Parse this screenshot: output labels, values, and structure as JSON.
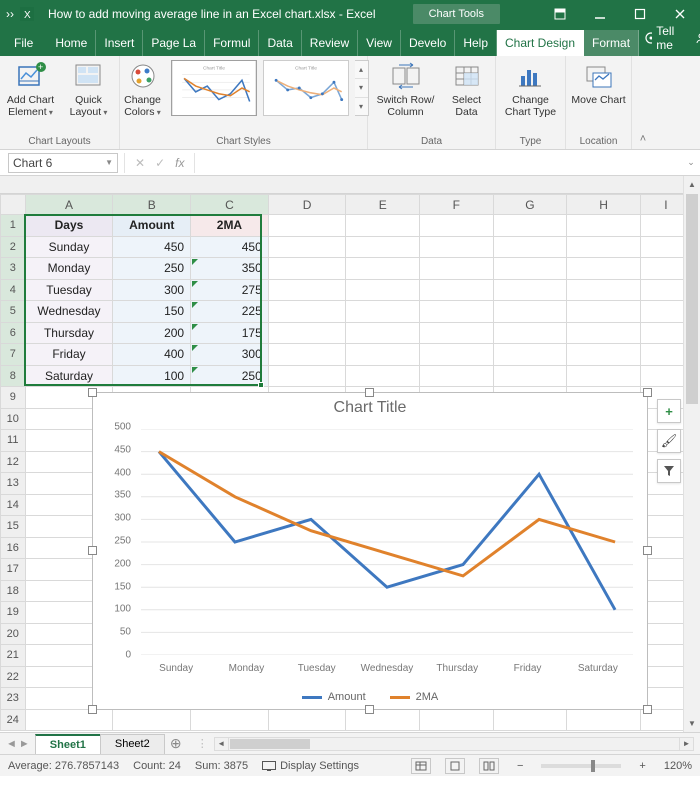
{
  "title": {
    "qat": "››",
    "document": "How to add moving average line in an Excel chart.xlsx  -  Excel",
    "context_tab": "Chart Tools"
  },
  "tabs": {
    "items": [
      "File",
      "Home",
      "Insert",
      "Page La",
      "Formul",
      "Data",
      "Review",
      "View",
      "Develo",
      "Help",
      "Chart Design",
      "Format"
    ],
    "active_index": 10,
    "context_indices": [
      10,
      11
    ],
    "tellme": "Tell me",
    "share": "Share"
  },
  "ribbon": {
    "chart_layouts": {
      "add_element": "Add Chart Element",
      "quick_layout": "Quick Layout",
      "group": "Chart Layouts"
    },
    "chart_styles": {
      "change_colors": "Change Colors",
      "group": "Chart Styles"
    },
    "data": {
      "switch": "Switch Row/\nColumn",
      "select": "Select Data",
      "group": "Data"
    },
    "type": {
      "change_type": "Change Chart Type",
      "group": "Type"
    },
    "location": {
      "move": "Move Chart",
      "group": "Location"
    }
  },
  "fx": {
    "namebox": "Chart 6",
    "cancel": "✕",
    "enter": "✓",
    "fx": "fx"
  },
  "columns": [
    "A",
    "B",
    "C",
    "D",
    "E",
    "F",
    "G",
    "H",
    "I"
  ],
  "col_sel": [
    0,
    1,
    2
  ],
  "rows_total": 24,
  "row_sel": [
    1,
    2,
    3,
    4,
    5,
    6,
    7,
    8
  ],
  "table": {
    "headers": [
      "Days",
      "Amount",
      "2MA"
    ],
    "rows": [
      [
        "Sunday",
        450,
        450
      ],
      [
        "Monday",
        250,
        350
      ],
      [
        "Tuesday",
        300,
        275
      ],
      [
        "Wednesday",
        150,
        225
      ],
      [
        "Thursday",
        200,
        175
      ],
      [
        "Friday",
        400,
        300
      ],
      [
        "Saturday",
        100,
        250
      ]
    ]
  },
  "chart_data": {
    "type": "line",
    "title": "Chart Title",
    "categories": [
      "Sunday",
      "Monday",
      "Tuesday",
      "Wednesday",
      "Thursday",
      "Friday",
      "Saturday"
    ],
    "series": [
      {
        "name": "Amount",
        "color": "#3e78c0",
        "values": [
          450,
          250,
          300,
          150,
          200,
          400,
          100
        ]
      },
      {
        "name": "2MA",
        "color": "#e0822c",
        "values": [
          450,
          350,
          275,
          225,
          175,
          300,
          250
        ]
      }
    ],
    "ylim": [
      0,
      500
    ],
    "ystep": 50,
    "xlabel": "",
    "ylabel": ""
  },
  "chart_side": {
    "add": "+",
    "brush": "🖌",
    "filter": "▼"
  },
  "sheets": {
    "items": [
      "Sheet1",
      "Sheet2"
    ],
    "active_index": 0,
    "add": "⊕"
  },
  "status": {
    "average_lbl": "Average:",
    "average": "276.7857143",
    "count_lbl": "Count:",
    "count": "24",
    "sum_lbl": "Sum:",
    "sum": "3875",
    "display": "Display Settings",
    "zoom": "120%"
  }
}
